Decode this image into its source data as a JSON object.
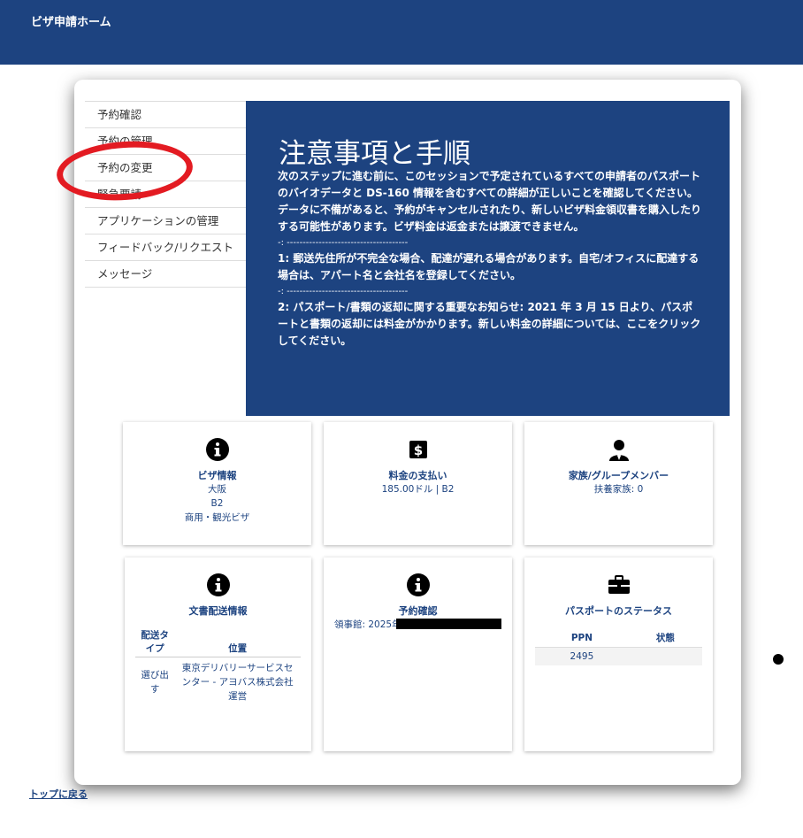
{
  "header": {
    "home_link": "ビザ申請ホーム"
  },
  "sidebar": {
    "items": [
      {
        "label": "予約確認"
      },
      {
        "label": "予約の管理"
      },
      {
        "label": "予約の変更"
      },
      {
        "label": "緊急要請"
      },
      {
        "label": "アプリケーションの管理"
      },
      {
        "label": "フィードバック/リクエスト"
      },
      {
        "label": "メッセージ"
      }
    ]
  },
  "notice": {
    "title": "注意事項と手順",
    "paragraph1": "次のステップに進む前に、このセッションで予定されているすべての申請者のパスポートのバイオデータと DS-160 情報を含むすべての詳細が正しいことを確認してください。データに不備があると、予約がキャンセルされたり、新しいビザ料金領収書を購入したりする可能性があります。ビザ料金は返金または譲渡できません。",
    "separator": "-: --------------------------------------",
    "item1": "1: 郵送先住所が不完全な場合、配達が遅れる場合があります。自宅/オフィスに配達する場合は、アパート名と会社名を登録してください。",
    "item2": "2: パスポート/書類の返却に関する重要なお知らせ: 2021 年 3 月 15 日より、パスポートと書類の返却には料金がかかります。新しい料金の詳細については、ここをクリックしてください。"
  },
  "cards": {
    "visa": {
      "icon": "info-icon",
      "title": "ビザ情報",
      "city": "大阪",
      "class": "B2",
      "type": "商用・観光ビザ"
    },
    "payment": {
      "icon": "dollar-icon",
      "title": "料金の支払い",
      "amount": "185.00ドル | B2"
    },
    "family": {
      "icon": "user-icon",
      "title": "家族/グループメンバー",
      "dependents": "扶養家族: 0"
    },
    "delivery": {
      "icon": "info-icon",
      "title": "文書配送情報",
      "col1": "配送タイプ",
      "col2": "位置",
      "row_type": "選び出す",
      "row_location": "東京デリバリーサービスセンター - アヨバス株式会社運営"
    },
    "appointment": {
      "icon": "info-icon",
      "title": "予約確認",
      "consulate": "領事館: 2025年"
    },
    "passport": {
      "icon": "briefcase-icon",
      "title": "パスポートのステータス",
      "col1": "PPN",
      "col2": "状態",
      "ppn": "2495",
      "status": ""
    }
  },
  "footer": {
    "back_to_top": "トップに戻る"
  },
  "colors": {
    "brand": "#1d4380",
    "annotation": "#e31b22"
  }
}
